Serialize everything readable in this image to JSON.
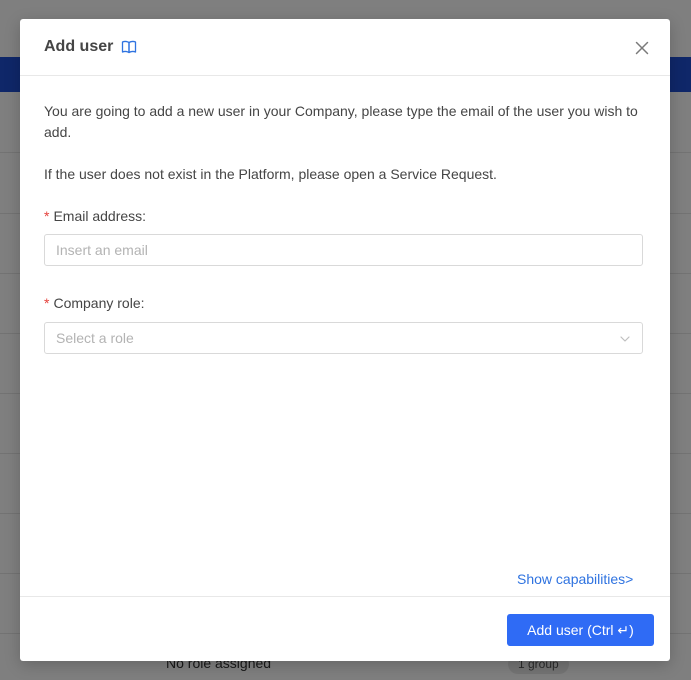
{
  "background": {
    "row_text": "No role assigned",
    "row_tag": "1 group"
  },
  "modal": {
    "title": "Add user",
    "title_icon": "book-open-icon",
    "close_icon": "close-icon",
    "intro": "You are going to add a new user in your Company, please type the email of the user you wish to add.",
    "notice": "If the user does not exist in the Platform, please open a Service Request.",
    "required_mark": "*",
    "email": {
      "label": "Email address:",
      "placeholder": "Insert an email",
      "value": ""
    },
    "role": {
      "label": "Company role:",
      "placeholder": "Select a role",
      "icon": "chevron-down-icon"
    },
    "capabilities_link": "Show capabilities>",
    "submit_label": "Add user (Ctrl ↵)"
  },
  "colors": {
    "primary": "#2f6bf5",
    "link": "#2f73e0",
    "required": "#e5413c",
    "header_bar": "#1f4fd3"
  }
}
